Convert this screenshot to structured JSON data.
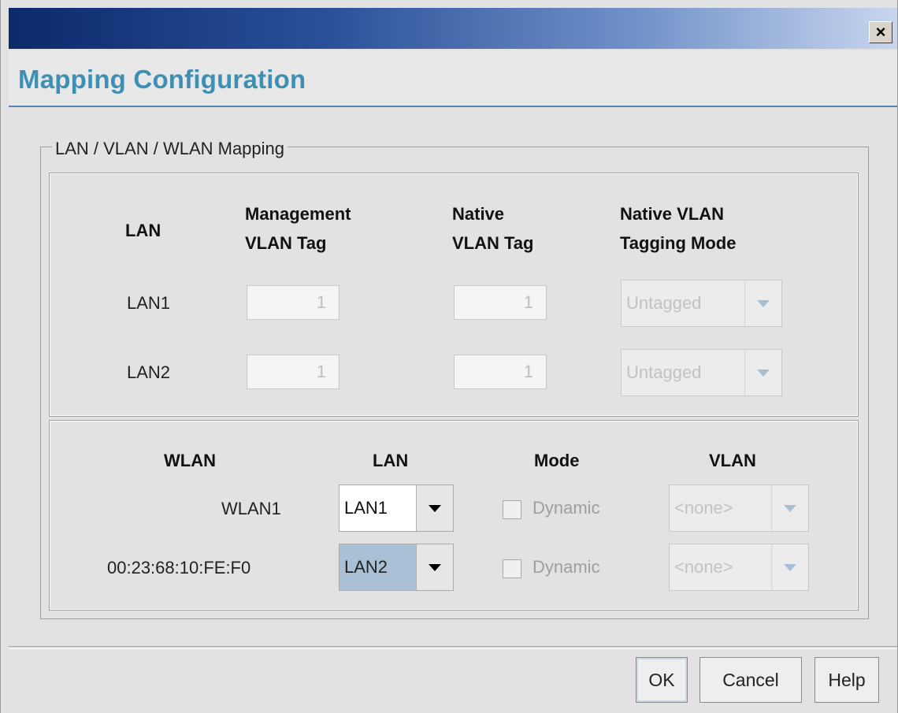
{
  "window": {
    "close_glyph": "×"
  },
  "header": {
    "title": "Mapping Configuration"
  },
  "group": {
    "legend": "LAN / VLAN / WLAN Mapping"
  },
  "lan_table": {
    "headers": {
      "lan": "LAN",
      "mgmt_1": "Management",
      "mgmt_2": "VLAN Tag",
      "native_1": "Native",
      "native_2": "VLAN Tag",
      "mode_1": "Native VLAN",
      "mode_2": "Tagging Mode"
    },
    "rows": [
      {
        "lan": "LAN1",
        "mgmt_tag": "1",
        "native_tag": "1",
        "tagging_mode": "Untagged"
      },
      {
        "lan": "LAN2",
        "mgmt_tag": "1",
        "native_tag": "1",
        "tagging_mode": "Untagged"
      }
    ]
  },
  "wlan_table": {
    "headers": {
      "wlan": "WLAN",
      "lan": "LAN",
      "mode": "Mode",
      "vlan": "VLAN"
    },
    "rows": [
      {
        "wlan": "WLAN1",
        "lan": "LAN1",
        "mode_label": "Dynamic",
        "vlan": "<none>"
      },
      {
        "wlan": "00:23:68:10:FE:F0",
        "lan": "LAN2",
        "mode_label": "Dynamic",
        "vlan": "<none>"
      }
    ]
  },
  "buttons": {
    "ok": "OK",
    "cancel": "Cancel",
    "help": "Help"
  }
}
